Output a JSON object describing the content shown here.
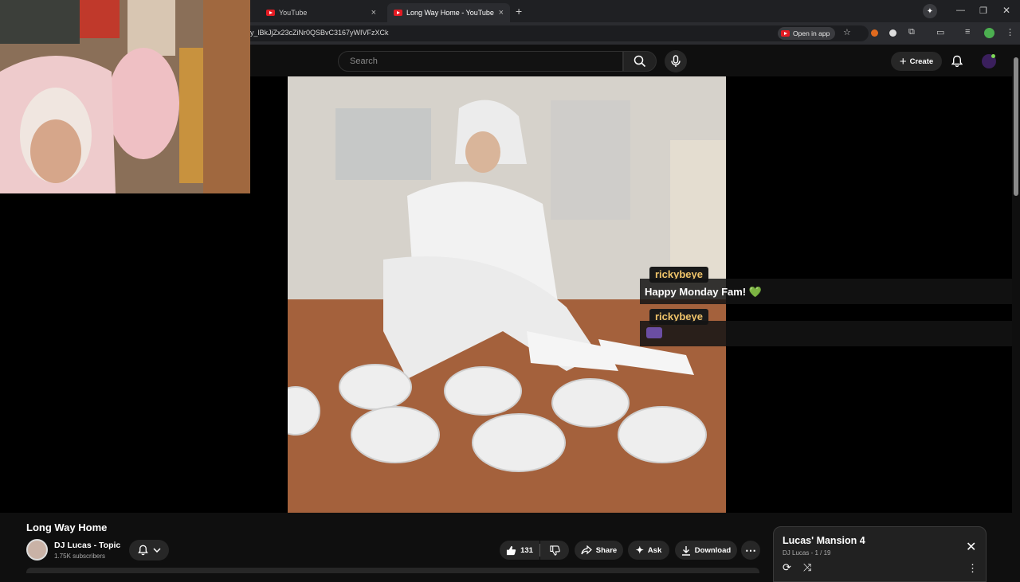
{
  "browser": {
    "tabs": [
      {
        "label": "YouTube",
        "close": "×"
      },
      {
        "label": "Long Way Home - YouTube",
        "close": "×"
      }
    ],
    "new_tab": "+",
    "url": "y_lBkJjZx23cZiNr0QSBvC3167yWIVFzXCk",
    "open_in_app": "Open in app"
  },
  "youtube": {
    "search_placeholder": "Search",
    "create_label": "Create"
  },
  "chat": [
    {
      "user": "rickybeye",
      "message": "Happy Monday Fam! 💚"
    },
    {
      "user": "rickybeye",
      "message": ""
    }
  ],
  "video": {
    "title": "Long Way Home",
    "channel": "DJ Lucas - Topic",
    "subscribers": "1.75K subscribers",
    "likes": "131",
    "share_label": "Share",
    "ask_label": "Ask",
    "download_label": "Download"
  },
  "playlist": {
    "title": "Lucas' Mansion 4",
    "subtitle": "DJ Lucas - 1 / 19"
  },
  "colors": {
    "chat_name": "#f0c46a",
    "youtube_red": "#e31b23",
    "background": "#0f0f0f"
  }
}
